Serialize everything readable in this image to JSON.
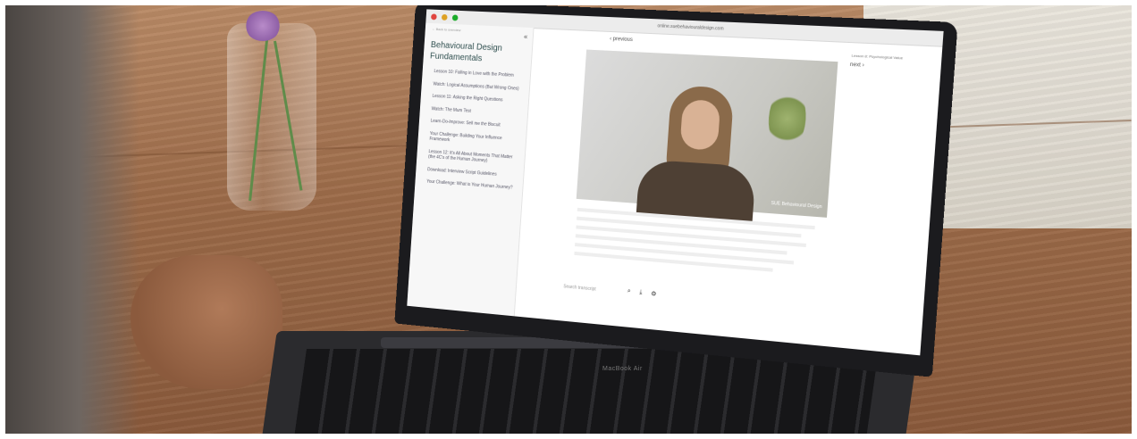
{
  "browser": {
    "url": "online.suebehaviouraldesign.com"
  },
  "sidebar": {
    "back_link": "← Back to overview",
    "course_title": "Behavioural Design Fundamentals",
    "items": [
      {
        "label": "Lesson 10: Falling in Love with the Problem"
      },
      {
        "label": "Watch: Logical Assumptions (But Wrong Ones)"
      },
      {
        "label": "Lesson 11: Asking the Right Questions"
      },
      {
        "label": "Watch: The Mum Test"
      },
      {
        "label": "Learn-Do-Improve: Sell me the Biscuit"
      },
      {
        "label": "Your Challenge: Building Your Influence Framework"
      },
      {
        "label": "Lesson 12: It's All About Moments That Matter (the 4C's of the Human Journey)"
      },
      {
        "label": "Download: Interview Script Guidelines"
      },
      {
        "label": "Your Challenge: What is Your Human Journey?"
      }
    ]
  },
  "player": {
    "previous_label": "‹ previous",
    "next_label": "next ›",
    "lesson_tag": "Lesson 8: Psychological Value",
    "caption": "SUE Behavioural Design",
    "transcript_placeholder": "Search transcript"
  },
  "laptop": {
    "brand": "MacBook Air"
  },
  "icons": {
    "collapse": "double-chevron-left-icon",
    "search": "search-icon",
    "download": "download-icon",
    "settings": "gear-icon"
  }
}
